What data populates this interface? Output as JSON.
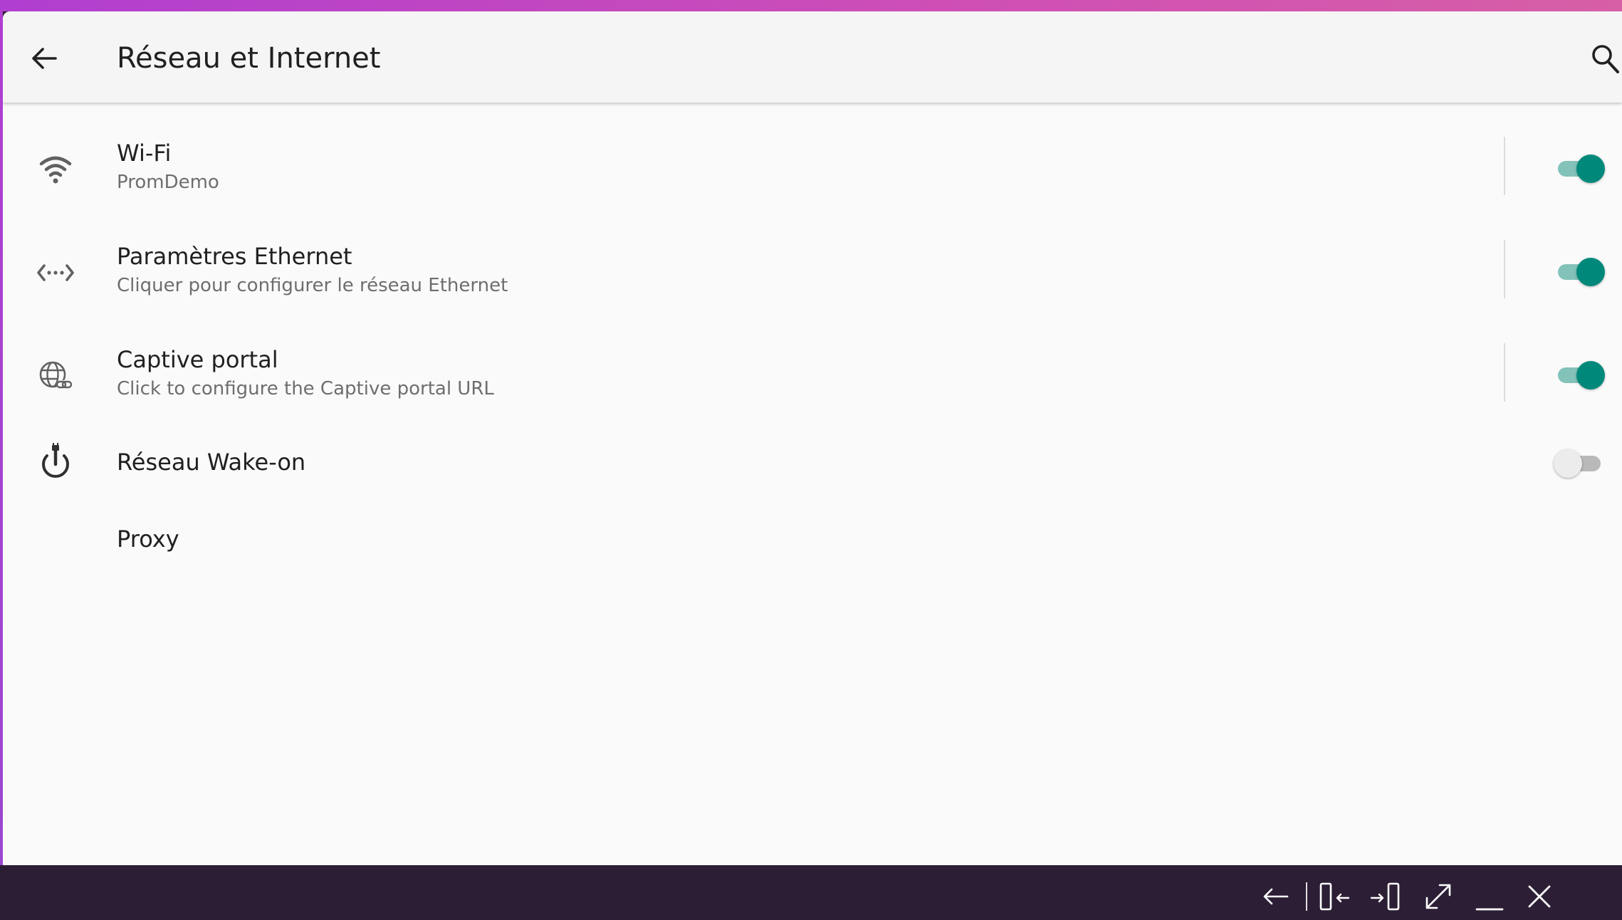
{
  "colors": {
    "accent": "#00897b",
    "accent_track": "#83c2b9",
    "taskbar": "#2c1f35",
    "title_text": "#202020",
    "subtitle_text": "#6e6e6e"
  },
  "app_bar": {
    "title": "Réseau et Internet",
    "back_icon": "arrow-left-icon",
    "search_icon": "search-icon"
  },
  "settings": {
    "wifi": {
      "icon": "wifi-icon",
      "title": "Wi-Fi",
      "subtitle": "PromDemo",
      "enabled": true
    },
    "ethernet": {
      "icon": "ethernet-icon",
      "title": "Paramètres Ethernet",
      "subtitle": "Cliquer pour configurer le réseau Ethernet",
      "enabled": true
    },
    "captive": {
      "icon": "globe-link-icon",
      "title": "Captive portal",
      "subtitle": "Click to configure the Captive portal URL",
      "enabled": true
    },
    "wake": {
      "icon": "power-plug-icon",
      "title": "Réseau Wake-on",
      "enabled": false
    },
    "proxy": {
      "title": "Proxy"
    }
  },
  "taskbar": {
    "icons": [
      "arrow-left-icon",
      "dock-left-icon",
      "dock-right-icon",
      "expand-icon",
      "minimize-icon",
      "close-icon"
    ]
  }
}
